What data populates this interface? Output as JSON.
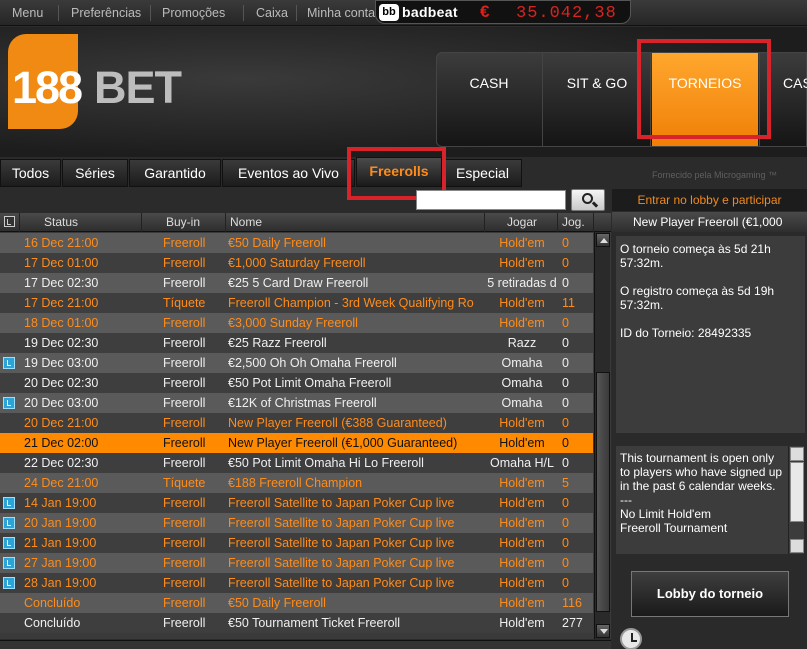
{
  "topbar": {
    "menu": "Menu",
    "prefs": "Preferências",
    "promos": "Promoções",
    "cashier": "Caixa",
    "account": "Minha conta",
    "badbeat_logo": "bb",
    "badbeat_label": "badbeat",
    "badbeat_currency": "€",
    "badbeat_amount": "35.042,38"
  },
  "brand": {
    "num": "188",
    "word": "BET"
  },
  "mainnav": {
    "cash": "CASH",
    "sitgo": "SIT & GO",
    "torneios": "TORNEIOS",
    "cas": "CAS"
  },
  "subtabs": {
    "todos": "Todos",
    "series": "Séries",
    "garantido": "Garantido",
    "ao_vivo": "Eventos ao Vivo",
    "freerolls": "Freerolls",
    "especial": "Especial"
  },
  "powered_by": "Fornecido pela Microgaming ™",
  "search": {
    "value": "",
    "placeholder": ""
  },
  "enter_lobby": "Entrar no lobby e participar",
  "columns": {
    "status": "Status",
    "buyin": "Buy-in",
    "nome": "Nome",
    "jogar": "Jogar",
    "jog": "Jog."
  },
  "rows": [
    {
      "status": "16 Dec 21:00",
      "buyin": "Freeroll",
      "nome": "€50 Daily Freeroll",
      "jogar": "Hold'em",
      "jog": "0",
      "color": "orange",
      "icon": false
    },
    {
      "status": "17 Dec 01:00",
      "buyin": "Freeroll",
      "nome": "€1,000 Saturday Freeroll",
      "jogar": "Hold'em",
      "jog": "0",
      "color": "orange",
      "icon": false
    },
    {
      "status": "17 Dec 02:30",
      "buyin": "Freeroll",
      "nome": "€25 5 Card Draw Freeroll",
      "jogar": "5 retiradas d",
      "jog": "0",
      "color": "white",
      "icon": false
    },
    {
      "status": "17 Dec 21:00",
      "buyin": "Tíquete",
      "nome": "Freeroll Champion - 3rd Week Qualifying Ro",
      "jogar": "Hold'em",
      "jog": "11",
      "color": "orange",
      "icon": false
    },
    {
      "status": "18 Dec 01:00",
      "buyin": "Freeroll",
      "nome": "€3,000 Sunday Freeroll",
      "jogar": "Hold'em",
      "jog": "0",
      "color": "orange",
      "icon": false
    },
    {
      "status": "19 Dec 02:30",
      "buyin": "Freeroll",
      "nome": "€25 Razz Freeroll",
      "jogar": "Razz",
      "jog": "0",
      "color": "white",
      "icon": false
    },
    {
      "status": "19 Dec 03:00",
      "buyin": "Freeroll",
      "nome": "€2,500 Oh Oh Omaha Freeroll",
      "jogar": "Omaha",
      "jog": "0",
      "color": "white",
      "icon": true
    },
    {
      "status": "20 Dec 02:30",
      "buyin": "Freeroll",
      "nome": "€50 Pot Limit Omaha Freeroll",
      "jogar": "Omaha",
      "jog": "0",
      "color": "white",
      "icon": false
    },
    {
      "status": "20 Dec 03:00",
      "buyin": "Freeroll",
      "nome": "€12K of Christmas Freeroll",
      "jogar": "Omaha",
      "jog": "0",
      "color": "white",
      "icon": true
    },
    {
      "status": "20 Dec 21:00",
      "buyin": "Freeroll",
      "nome": "New Player Freeroll (€388 Guaranteed)",
      "jogar": "Hold'em",
      "jog": "0",
      "color": "orange",
      "icon": false
    },
    {
      "status": "21 Dec 02:00",
      "buyin": "Freeroll",
      "nome": "New Player Freeroll (€1,000 Guaranteed)",
      "jogar": "Hold'em",
      "jog": "0",
      "color": "orange",
      "icon": false,
      "selected": true
    },
    {
      "status": "22 Dec 02:30",
      "buyin": "Freeroll",
      "nome": "€50 Pot Limit Omaha Hi Lo Freeroll",
      "jogar": "Omaha H/L",
      "jog": "0",
      "color": "white",
      "icon": false
    },
    {
      "status": "24 Dec 21:00",
      "buyin": "Tíquete",
      "nome": "€188 Freeroll Champion",
      "jogar": "Hold'em",
      "jog": "5",
      "color": "orange",
      "icon": false
    },
    {
      "status": "14 Jan 19:00",
      "buyin": "Freeroll",
      "nome": " Freeroll Satellite to Japan Poker Cup live",
      "jogar": "Hold'em",
      "jog": "0",
      "color": "orange",
      "icon": true
    },
    {
      "status": "20 Jan 19:00",
      "buyin": "Freeroll",
      "nome": " Freeroll Satellite to Japan Poker Cup live",
      "jogar": "Hold'em",
      "jog": "0",
      "color": "orange",
      "icon": true
    },
    {
      "status": "21 Jan 19:00",
      "buyin": "Freeroll",
      "nome": " Freeroll Satellite to Japan Poker Cup live",
      "jogar": "Hold'em",
      "jog": "0",
      "color": "orange",
      "icon": true
    },
    {
      "status": "27 Jan 19:00",
      "buyin": "Freeroll",
      "nome": " Freeroll Satellite to Japan Poker Cup live",
      "jogar": "Hold'em",
      "jog": "0",
      "color": "orange",
      "icon": true
    },
    {
      "status": "28 Jan 19:00",
      "buyin": "Freeroll",
      "nome": " Freeroll Satellite to Japan Poker Cup live",
      "jogar": "Hold'em",
      "jog": "0",
      "color": "orange",
      "icon": true
    },
    {
      "status": "Concluído",
      "buyin": "Freeroll",
      "nome": "€50 Daily Freeroll",
      "jogar": "Hold'em",
      "jog": "116",
      "color": "orange",
      "icon": false
    },
    {
      "status": "Concluído",
      "buyin": "Freeroll",
      "nome": "€50 Tournament Ticket Freeroll",
      "jogar": "Hold'em",
      "jog": "277",
      "color": "white",
      "icon": false
    }
  ],
  "details": {
    "title": "New Player Freeroll (€1,000",
    "starts": "O torneio começa às 5d 21h 57:32m.",
    "registration": "O registro começa às 5d 19h 57:32m.",
    "id": "ID do Torneio: 28492335",
    "desc1": "This tournament is open only to players who have signed up in the past 6 calendar weeks.",
    "desc2": "---",
    "desc3": "No Limit Hold'em",
    "desc4": "Freeroll Tournament",
    "lobby_button": "Lobby do torneio"
  },
  "colors": {
    "accent": "#ff8a00",
    "row_orange_text": "#ff8c1a",
    "highlight_box": "#d8232a"
  }
}
